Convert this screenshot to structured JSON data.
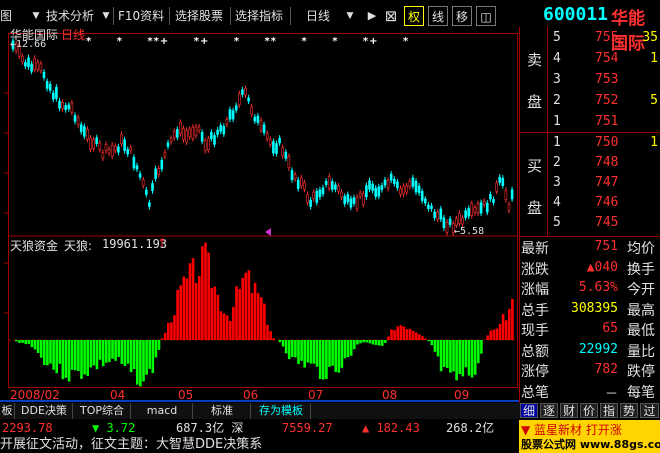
{
  "toolbar": {
    "left_stub": "图",
    "tech_menu": "技术分析",
    "f10": "F10资料",
    "pick_stock": "选择股票",
    "pick_indicator": "选择指标",
    "period": "日线",
    "right_glyph": "权",
    "line_glyph": "线",
    "move_glyph": "移",
    "icon_glyph": "◫",
    "dropdown_arrow": "▼",
    "play_arrow": "▶",
    "cross_icon": "⊠"
  },
  "stock": {
    "code": "600011",
    "name": "华能国际"
  },
  "main_chart": {
    "title_name": "华能国际",
    "title_period": "日线",
    "high_label": "←12.66",
    "low_label": "←5.58",
    "markers_text": "* * **+ *+ * ** * * *+ *"
  },
  "indicator": {
    "title": "天狼资金",
    "label": "天狼:",
    "value": "19961.193",
    "arrow": "↑"
  },
  "xaxis": {
    "labels": [
      "2008/02",
      "04",
      "05",
      "06",
      "07",
      "08",
      "09"
    ]
  },
  "order_book": {
    "sell_label_1": "卖",
    "sell_label_2": "盘",
    "buy_label_1": "买",
    "buy_label_2": "盘",
    "sells": [
      {
        "level": "5",
        "price": "755",
        "vol": "35"
      },
      {
        "level": "4",
        "price": "754",
        "vol": "1"
      },
      {
        "level": "3",
        "price": "753",
        "vol": ""
      },
      {
        "level": "2",
        "price": "752",
        "vol": "5"
      },
      {
        "level": "1",
        "price": "751",
        "vol": ""
      }
    ],
    "buys": [
      {
        "level": "1",
        "price": "750",
        "vol": "1"
      },
      {
        "level": "2",
        "price": "748",
        "vol": ""
      },
      {
        "level": "3",
        "price": "747",
        "vol": ""
      },
      {
        "level": "4",
        "price": "746",
        "vol": ""
      },
      {
        "level": "5",
        "price": "745",
        "vol": ""
      }
    ]
  },
  "quote": [
    {
      "label": "最新",
      "value": "751",
      "color": "#ff3030",
      "label2": "均价"
    },
    {
      "label": "涨跌",
      "value": "▲040",
      "color": "#ff3030",
      "label2": "换手"
    },
    {
      "label": "涨幅",
      "value": "5.63%",
      "color": "#ff3030",
      "label2": "今开"
    },
    {
      "label": "总手",
      "value": "308395",
      "color": "#ffff00",
      "label2": "最高"
    },
    {
      "label": "现手",
      "value": "65",
      "color": "#ff3030",
      "label2": "最低"
    },
    {
      "label": "总额",
      "value": "22992",
      "color": "#00ffff",
      "label2": "量比"
    },
    {
      "label": "涨停",
      "value": "782",
      "color": "#ff3030",
      "label2": "跌停"
    },
    {
      "label": "总笔",
      "value": "－",
      "color": "#e0e0e0",
      "label2": "每笔"
    }
  ],
  "bottom_tabs": [
    "板",
    "DDE决策",
    "TOP综合",
    "macd",
    "标准",
    "存为模板"
  ],
  "right_tabs": [
    "细",
    "逐",
    "财",
    "价",
    "指",
    "势",
    "过"
  ],
  "index_bar": [
    {
      "text": "2293.78",
      "color": "#ff3030"
    },
    {
      "text": "▼ 3.72",
      "color": "#00ff00"
    },
    {
      "text": "687.3亿 深",
      "color": "#e0e0e0"
    },
    {
      "text": "7559.27",
      "color": "#ff3030"
    },
    {
      "text": "▲ 182.43",
      "color": "#ff3030"
    },
    {
      "text": "268.2亿",
      "color": "#e0e0e0"
    }
  ],
  "ticker": "开展征文活动，征文主题：大智慧DDE决策系",
  "promo": {
    "line1": "▼ 蓝星新材 打开涨",
    "line2": "股票公式网 www.88gs.com"
  },
  "colors": {
    "up": "#ff3030",
    "down": "#00ffff",
    "bar_up": "#ff0000",
    "bar_down": "#00ff00",
    "frame": "#a00000"
  }
}
